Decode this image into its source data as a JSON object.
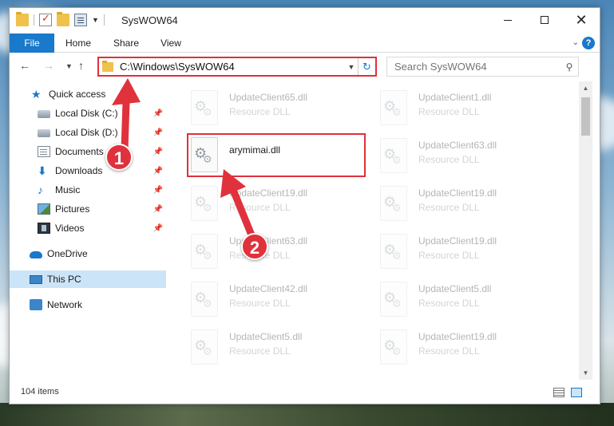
{
  "window": {
    "title": "SysWOW64",
    "minimize_icon": "minimize-icon",
    "maximize_icon": "maximize-icon",
    "close_icon": "close-icon"
  },
  "ribbon": {
    "tabs": [
      "File",
      "Home",
      "Share",
      "View"
    ],
    "help_label": "?"
  },
  "nav": {
    "address": "C:\\Windows\\SysWOW64",
    "search_placeholder": "Search SysWOW64"
  },
  "sidebar": {
    "items": [
      {
        "label": "Quick access",
        "icon": "star-icon",
        "pinned": false
      },
      {
        "label": "Local Disk (C:)",
        "icon": "drive-icon",
        "pinned": true
      },
      {
        "label": "Local Disk (D:)",
        "icon": "drive-icon",
        "pinned": true
      },
      {
        "label": "Documents",
        "icon": "document-icon",
        "pinned": true
      },
      {
        "label": "Downloads",
        "icon": "download-icon",
        "pinned": true
      },
      {
        "label": "Music",
        "icon": "music-icon",
        "pinned": true
      },
      {
        "label": "Pictures",
        "icon": "pictures-icon",
        "pinned": true
      },
      {
        "label": "Videos",
        "icon": "videos-icon",
        "pinned": true
      },
      {
        "label": "OneDrive",
        "icon": "cloud-icon",
        "pinned": false
      },
      {
        "label": "This PC",
        "icon": "computer-icon",
        "pinned": false,
        "selected": true
      },
      {
        "label": "Network",
        "icon": "network-icon",
        "pinned": false
      }
    ]
  },
  "files": {
    "left_column": [
      {
        "name": "UpdateClient65.dll",
        "type": "Resource DLL",
        "faded": true
      },
      {
        "name": "arymimai.dll",
        "type": "",
        "faded": false,
        "highlighted": true
      },
      {
        "name": "UpdateClient19.dll",
        "type": "Resource DLL",
        "faded": true
      },
      {
        "name": "UpdateClient63.dll",
        "type": "Resource DLL",
        "faded": true
      },
      {
        "name": "UpdateClient42.dll",
        "type": "Resource DLL",
        "faded": true
      },
      {
        "name": "UpdateClient5.dll",
        "type": "Resource DLL",
        "faded": true
      }
    ],
    "right_column": [
      {
        "name": "UpdateClient1.dll",
        "type": "Resource DLL",
        "faded": true
      },
      {
        "name": "UpdateClient63.dll",
        "type": "Resource DLL",
        "faded": true
      },
      {
        "name": "UpdateClient19.dll",
        "type": "Resource DLL",
        "faded": true
      },
      {
        "name": "UpdateClient19.dll",
        "type": "Resource DLL",
        "faded": true
      },
      {
        "name": "UpdateClient5.dll",
        "type": "Resource DLL",
        "faded": true
      },
      {
        "name": "UpdateClient19.dll",
        "type": "Resource DLL",
        "faded": true
      }
    ]
  },
  "status": {
    "item_count": "104 items"
  },
  "annotations": {
    "step1": "1",
    "step2": "2",
    "color": "#e0323c"
  },
  "colors": {
    "accent": "#1979ca",
    "highlight_border": "#e0303a",
    "selected_bg": "#cce4f7"
  }
}
